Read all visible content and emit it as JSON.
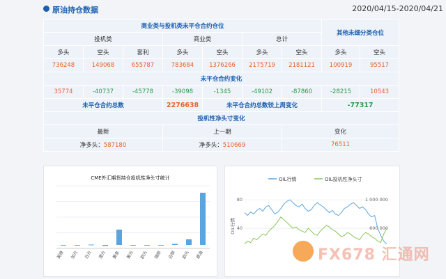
{
  "header": {
    "title": "原油持仓数据",
    "date_range": "2020/04/15-2020/04/21"
  },
  "table": {
    "section1_title": "商业类与投机类未平仓合约仓位",
    "other_title": "其他未细分类仓位",
    "group_spec": "投机类",
    "group_comm": "商业类",
    "group_total": "总计",
    "cols": [
      "多头",
      "空头",
      "套利",
      "多头",
      "空头",
      "多头",
      "空头",
      "多头",
      "空头"
    ],
    "values": [
      "736248",
      "149068",
      "655787",
      "783684",
      "1376266",
      "2175719",
      "2181121",
      "100919",
      "95517"
    ],
    "section2_title": "未平仓合约变化",
    "changes": [
      "35774",
      "-40737",
      "-45778",
      "-39098",
      "-1345",
      "-49102",
      "-87860",
      "-28215",
      "10543"
    ],
    "total_oi_label": "未平仓合约总数",
    "total_oi_value": "2276638",
    "total_oi_change_label": "未平仓合约总数较上周变化",
    "total_oi_change_value": "-77317",
    "section3_title": "投机性净头寸变化",
    "col_latest": "最新",
    "col_prev": "上一期",
    "col_change": "变化",
    "net_label": "净多头：",
    "net_latest": "587180",
    "net_prev": "510669",
    "net_change": "76511"
  },
  "colors": {
    "accent": "#1c5fb0",
    "positive": "#e8622b",
    "negative": "#2a9a4a",
    "bar": "#5aa4e0",
    "line_oil": "#5aa4e0",
    "line_net": "#8ac55a"
  },
  "chart_data": [
    {
      "type": "bar",
      "title": "CME外汇期货持仓投机性净头寸统计",
      "categories": [
        "英镑",
        "加元",
        "日元",
        "澳元",
        "黄金",
        "美元",
        "欧元",
        "瑞郎",
        "白银",
        "欧元",
        "原油"
      ],
      "values": [
        0,
        -1,
        0.5,
        -1.5,
        22,
        0,
        -0.5,
        0,
        1.5,
        8,
        75
      ],
      "ylim": [
        -5,
        85
      ]
    },
    {
      "type": "line",
      "legend": [
        "OIL行情",
        "OIL投机性净头寸"
      ],
      "ylabel": "OIL行情",
      "left_ticks": [
        "80",
        "40"
      ],
      "right_ticks": [
        "1 000 000",
        "600 000"
      ],
      "series": [
        {
          "name": "OIL行情",
          "axis": "left",
          "values": [
            62,
            58,
            63,
            60,
            65,
            68,
            64,
            70,
            72,
            66,
            60,
            63,
            68,
            74,
            78,
            80,
            76,
            72,
            70,
            74,
            68,
            64,
            66,
            72,
            76,
            73,
            70,
            66,
            62,
            65,
            60,
            58,
            62,
            68,
            70,
            74,
            76,
            72,
            68,
            70,
            66,
            60,
            56,
            58,
            40,
            30,
            22,
            18
          ]
        },
        {
          "name": "OIL投机性净头寸",
          "axis": "right",
          "values": [
            380000,
            420000,
            400000,
            460000,
            440000,
            480000,
            520000,
            500000,
            560000,
            600000,
            640000,
            700000,
            760000,
            720000,
            680000,
            640000,
            600000,
            620000,
            580000,
            560000,
            540000,
            600000,
            560000,
            520000,
            500000,
            560000,
            600000,
            640000,
            620000,
            580000,
            560000,
            520000,
            480000,
            500000,
            540000,
            520000,
            480000,
            460000,
            440000,
            500000,
            540000,
            520000,
            480000,
            460000,
            420000,
            400000,
            520000,
            600000
          ]
        }
      ]
    }
  ],
  "watermark": {
    "text": "FX678 汇通网"
  }
}
